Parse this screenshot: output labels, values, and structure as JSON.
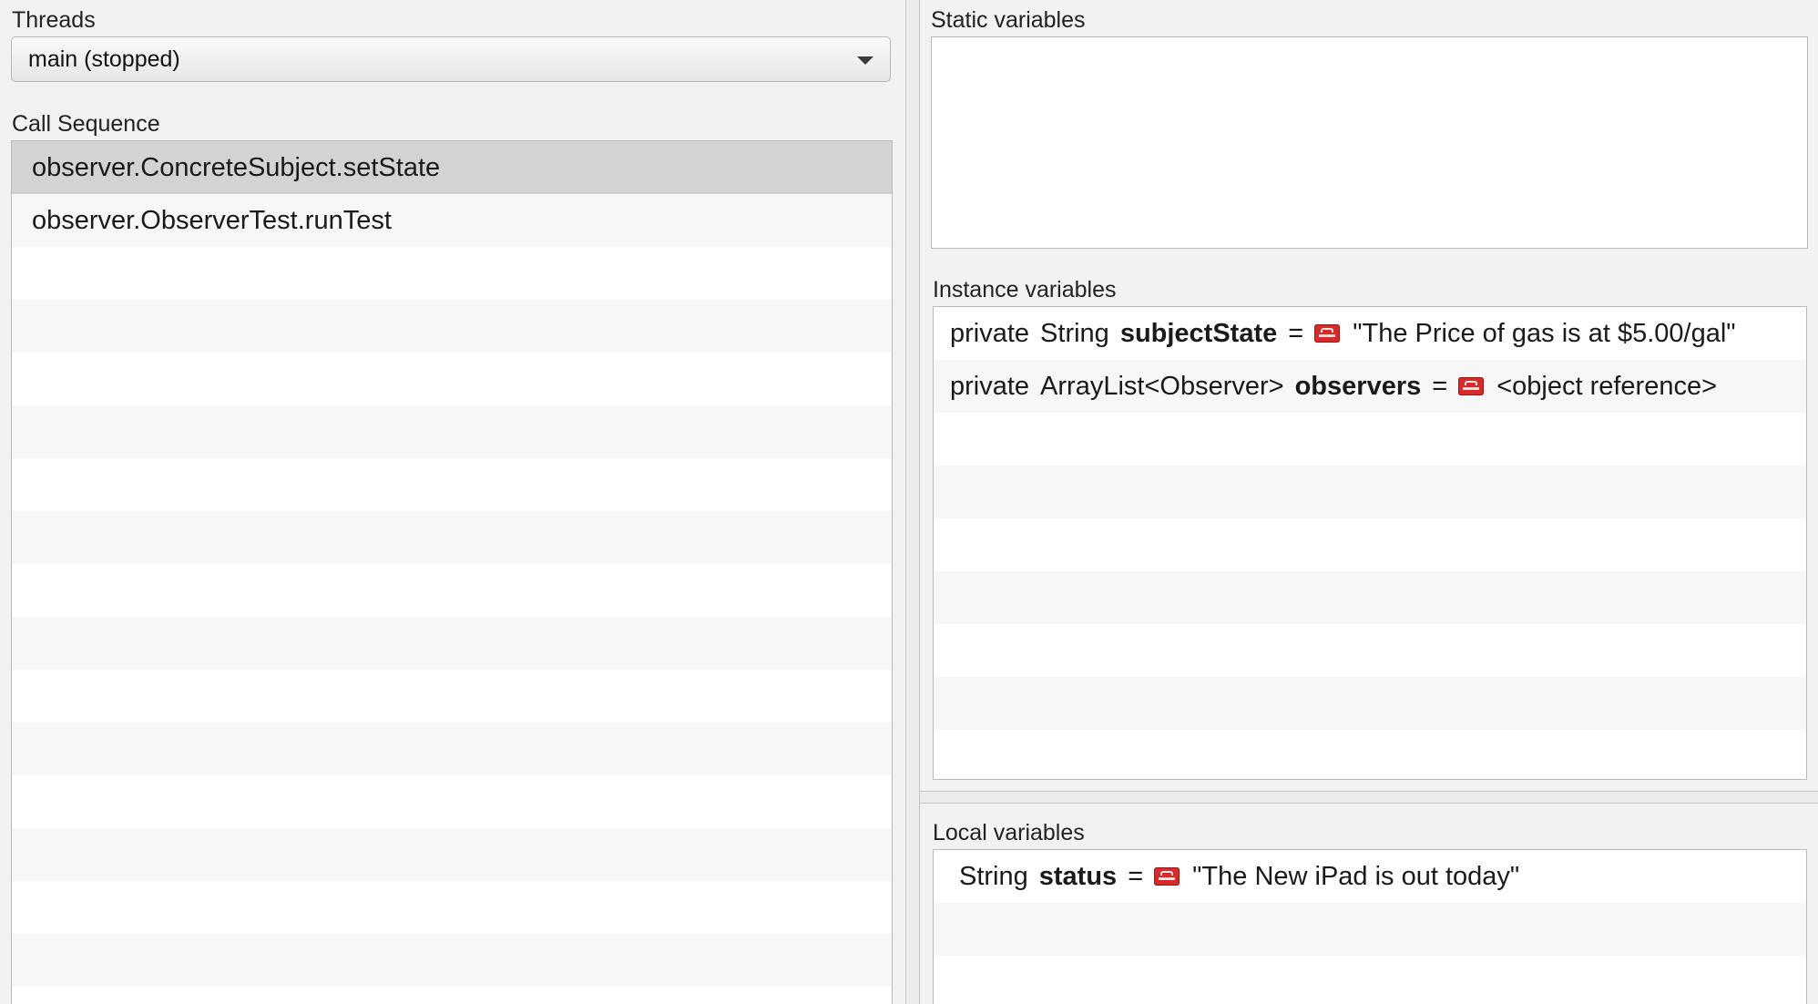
{
  "threads": {
    "label": "Threads",
    "selected": "main (stopped)"
  },
  "call_sequence": {
    "label": "Call Sequence",
    "items": [
      "observer.ConcreteSubject.setState",
      "observer.ObserverTest.runTest"
    ]
  },
  "static_variables": {
    "label": "Static variables"
  },
  "instance_variables": {
    "label": "Instance variables",
    "items": [
      {
        "modifier": "private",
        "type": "String",
        "name": "subjectState",
        "eq": "=",
        "icon": "object-icon",
        "value": "\"The Price of gas is at $5.00/gal\""
      },
      {
        "modifier": "private",
        "type": "ArrayList<Observer>",
        "name": "observers",
        "eq": "=",
        "icon": "object-icon",
        "value": "<object reference>"
      }
    ]
  },
  "local_variables": {
    "label": "Local variables",
    "items": [
      {
        "type": "String",
        "name": "status",
        "eq": "=",
        "icon": "object-icon",
        "value": "\"The New iPad is out today\""
      }
    ]
  },
  "colors": {
    "selected_row": "#d3d3d3",
    "object_icon": "#d42b2b"
  }
}
